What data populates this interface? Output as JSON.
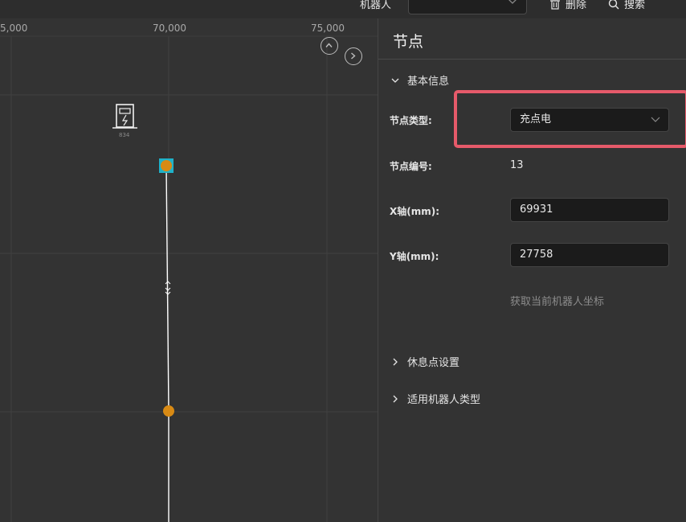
{
  "topbar": {
    "robot_label": "机器人",
    "robot_select_value": "",
    "delete_label": "删除",
    "search_label": "搜索"
  },
  "canvas": {
    "ruler_labels": [
      "5,000",
      "70,000",
      "75,000"
    ],
    "station_label": "834",
    "colors": {
      "path": "#ffffff",
      "node": "#d88a14",
      "selected_outline": "#1fb2c9"
    }
  },
  "panel": {
    "title": "节点",
    "basic_info_section": "基本信息",
    "node_type_label": "节点类型:",
    "node_type_value": "充点电",
    "node_id_label": "节点编号:",
    "node_id_value": "13",
    "x_label": "X轴(mm):",
    "x_value": "69931",
    "y_label": "Y轴(mm):",
    "y_value": "27758",
    "get_coords_link": "获取当前机器人坐标",
    "rest_point_section": "休息点设置",
    "robot_type_section": "适用机器人类型"
  }
}
